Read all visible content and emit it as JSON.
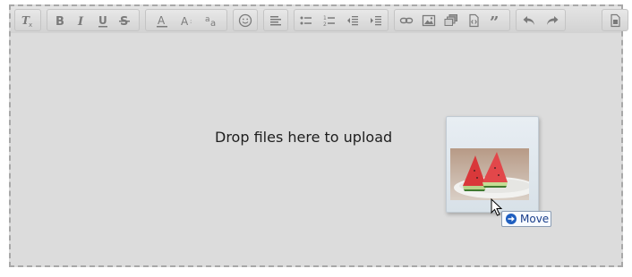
{
  "toolbar": {
    "groups": [
      {
        "name": "remove-format-group",
        "buttons": [
          "remove-format"
        ]
      },
      {
        "name": "basic-styles-group",
        "buttons": [
          "bold",
          "italic",
          "underline",
          "strikethrough"
        ]
      },
      {
        "name": "font-group",
        "buttons": [
          "text-color",
          "font-size",
          "subscript-superscript"
        ]
      },
      {
        "name": "emoji-group",
        "buttons": [
          "emoji"
        ]
      },
      {
        "name": "align-group",
        "buttons": [
          "align-left"
        ]
      },
      {
        "name": "list-group",
        "buttons": [
          "bulleted-list",
          "numbered-list",
          "decrease-indent",
          "increase-indent"
        ]
      },
      {
        "name": "insert-group",
        "buttons": [
          "link",
          "image",
          "gallery",
          "embed-code",
          "blockquote"
        ]
      },
      {
        "name": "history-group",
        "buttons": [
          "undo",
          "redo"
        ]
      },
      {
        "name": "source-group",
        "buttons": [
          "source"
        ]
      }
    ],
    "colors": {
      "icon": "#7a7a7a",
      "bar_top": "#e4e4e4",
      "bar_bottom": "#d2d2d2"
    }
  },
  "dropzone": {
    "message": "Drop files here to upload",
    "background": "#dcdcdc",
    "border_color": "#a8a8a8"
  },
  "drag": {
    "tooltip_label": "Move",
    "tooltip_icon": "arrow-right-icon",
    "tooltip_text_color": "#1a3e8a",
    "image_subject": "watermelon slices on a white plate"
  }
}
